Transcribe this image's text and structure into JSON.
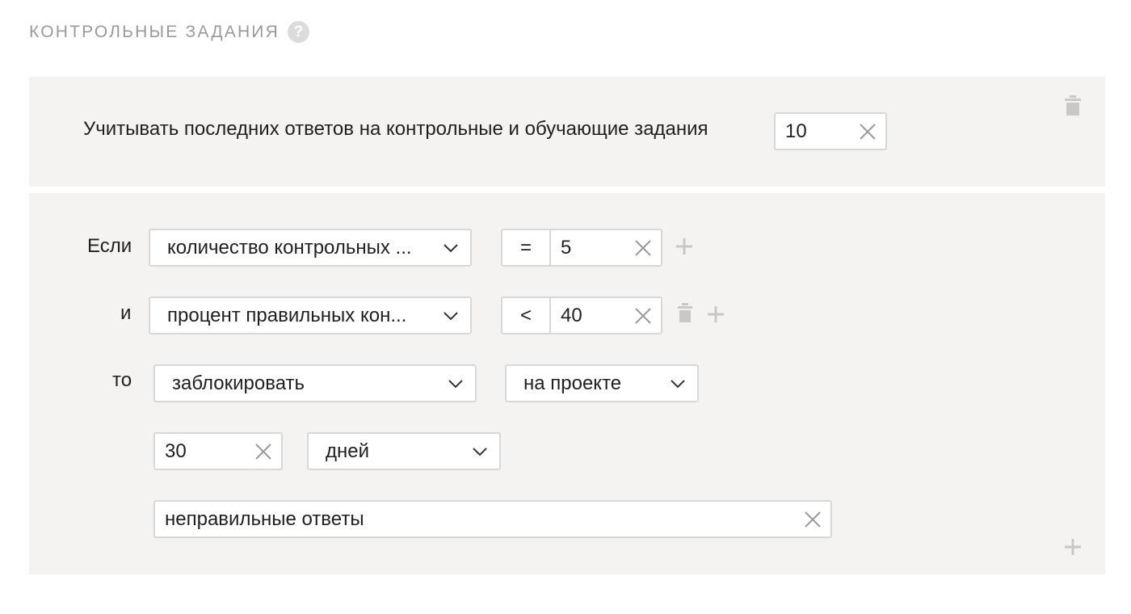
{
  "section": {
    "title": "КОНТРОЛЬНЫЕ ЗАДАНИЯ",
    "help_icon": "question-circle-icon",
    "help_symbol": "?"
  },
  "history": {
    "label": "Учитывать последних ответов на контрольные и обучающие задания",
    "value": "10",
    "delete_icon": "trash-icon"
  },
  "rule": {
    "conditions": [
      {
        "prefix": "Если",
        "field": "количество контрольных ...",
        "operator": "=",
        "value": "5"
      },
      {
        "prefix": "и",
        "field": "процент правильных кон...",
        "operator": "<",
        "value": "40"
      }
    ],
    "action": {
      "prefix": "то",
      "action_select": "заблокировать",
      "scope_select": "на проекте",
      "duration_value": "30",
      "duration_unit": "дней",
      "reason": "неправильные ответы"
    }
  },
  "colors": {
    "panel_bg": "#f4f3f1",
    "border": "#d8d8d8",
    "muted_icon": "#c8c8c8",
    "title_gray": "#9a9a9a"
  }
}
